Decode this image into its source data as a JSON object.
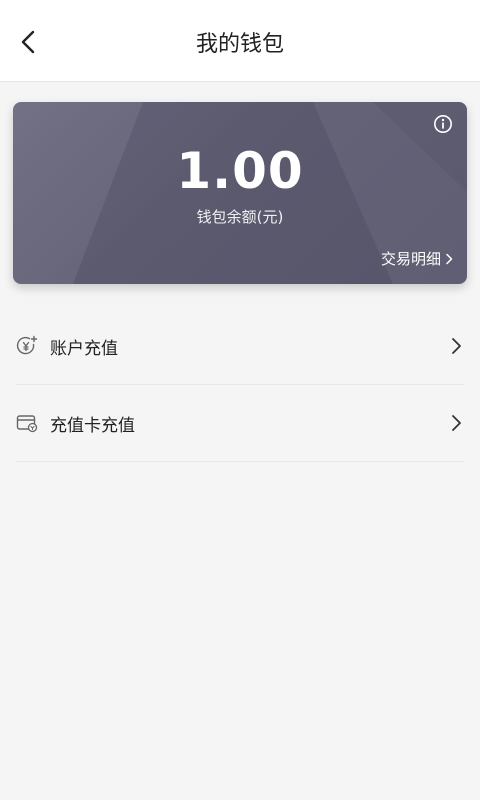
{
  "header": {
    "title": "我的钱包"
  },
  "wallet": {
    "balance": "1.00",
    "balance_label": "钱包余额(元)",
    "transactions_link": "交易明细"
  },
  "menu": [
    {
      "label": "账户充值",
      "icon": "yuan-plus-icon"
    },
    {
      "label": "充值卡充值",
      "icon": "card-icon"
    }
  ],
  "colors": {
    "card_bg": "#5f5d73",
    "page_bg": "#f5f5f5",
    "header_bg": "#ffffff"
  }
}
